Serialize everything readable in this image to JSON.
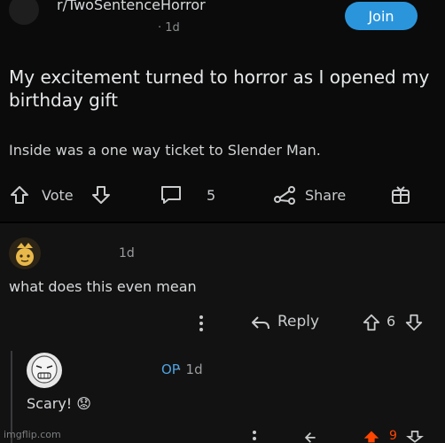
{
  "post": {
    "subreddit": "r/TwoSentenceHorror",
    "time": "· 1d",
    "join_label": "Join",
    "title": "My excitement turned to horror as I opened my birthday gift",
    "body": "Inside was a one way ticket to Slender Man.",
    "vote_label": "Vote",
    "comment_count": "5",
    "share_label": "Share"
  },
  "comments": [
    {
      "time": "1d",
      "text": "what does this even mean",
      "reply_label": "Reply",
      "votes": "6"
    },
    {
      "op_badge": "OP",
      "time": "· 1d",
      "text": "Scary! 😟",
      "votes": "9"
    }
  ],
  "watermark": "imgflip.com",
  "colors": {
    "join": "#2b95dc",
    "op": "#4fa3e3",
    "upvote_active": "#ff4500"
  }
}
